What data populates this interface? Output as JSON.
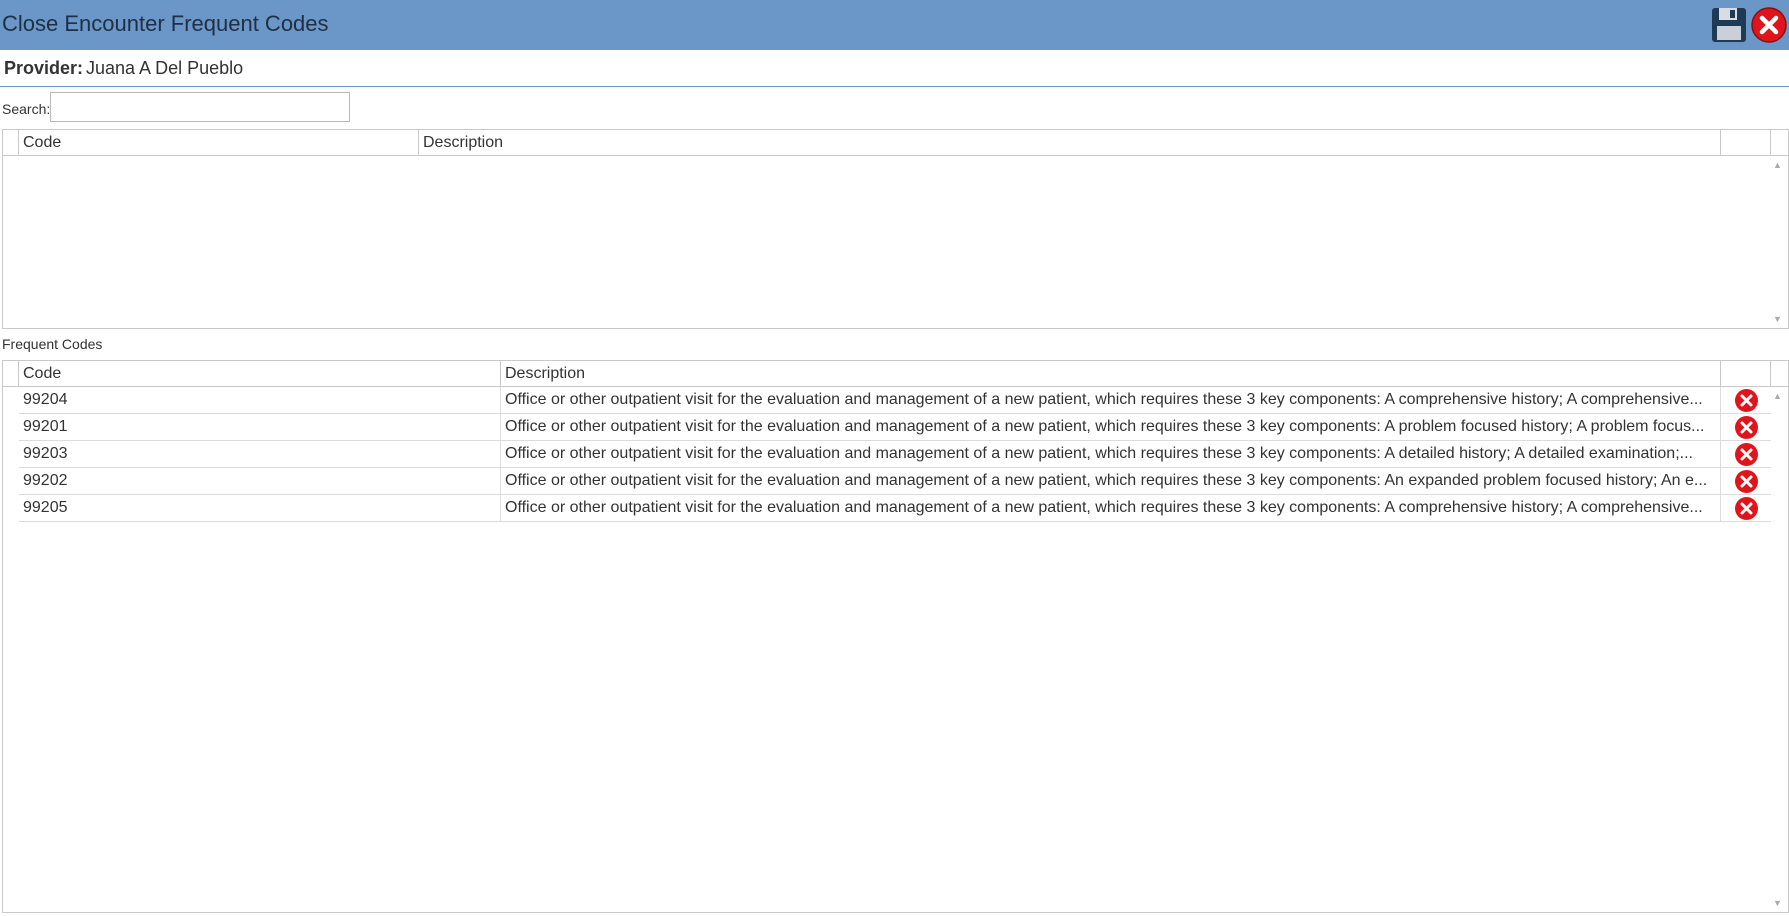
{
  "window": {
    "title": "Close Encounter Frequent Codes"
  },
  "provider": {
    "label": "Provider:",
    "name": "Juana A Del Pueblo"
  },
  "search": {
    "label": "Search:",
    "value": "",
    "placeholder": ""
  },
  "search_grid": {
    "columns": [
      "Code",
      "Description"
    ],
    "rows": []
  },
  "frequent": {
    "label": "Frequent Codes",
    "columns": [
      "Code",
      "Description"
    ],
    "rows": [
      {
        "code": "99204",
        "description": "Office or other outpatient visit for the evaluation and management of a new patient, which requires these 3 key components: A comprehensive history; A comprehensive..."
      },
      {
        "code": "99201",
        "description": "Office or other outpatient visit for the evaluation and management of a new patient, which requires these 3 key components: A problem focused history; A problem focus..."
      },
      {
        "code": "99203",
        "description": "Office or other outpatient visit for the evaluation and management of a new patient, which requires these 3 key components: A detailed history; A detailed examination;..."
      },
      {
        "code": "99202",
        "description": "Office or other outpatient visit for the evaluation and management of a new patient, which requires these 3 key components: An expanded problem focused history; An e..."
      },
      {
        "code": "99205",
        "description": "Office or other outpatient visit for the evaluation and management of a new patient, which requires these 3 key components: A comprehensive history; A comprehensive..."
      }
    ]
  },
  "icons": {
    "save": "save-icon",
    "close": "close-icon",
    "delete": "delete-icon"
  },
  "colors": {
    "titlebar": "#6b96c8",
    "delete": "#e0151b"
  }
}
